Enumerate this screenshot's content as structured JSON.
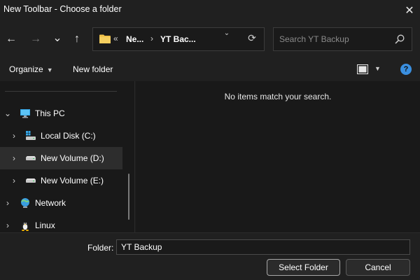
{
  "window": {
    "title": "New Toolbar - Choose a folder",
    "close_glyph": "✕"
  },
  "nav": {
    "back_glyph": "←",
    "forward_glyph": "→",
    "recent_glyph": "⌄",
    "up_glyph": "↑"
  },
  "address": {
    "overflow": "«",
    "segments": [
      "Ne...",
      "YT Bac..."
    ],
    "separator": "›",
    "refresh_glyph": "⟳"
  },
  "search": {
    "placeholder": "Search YT Backup"
  },
  "toolbar": {
    "organize_label": "Organize",
    "new_folder_label": "New folder",
    "help_glyph": "?"
  },
  "tree": {
    "items": [
      {
        "label": "This PC",
        "icon": "computer-icon"
      },
      {
        "label": "Local Disk (C:)",
        "icon": "system-drive-icon"
      },
      {
        "label": "New Volume (D:)",
        "icon": "drive-icon",
        "selected": true
      },
      {
        "label": "New Volume (E:)",
        "icon": "drive-icon"
      },
      {
        "label": "Network",
        "icon": "network-icon"
      },
      {
        "label": "Linux",
        "icon": "linux-penguin-icon"
      }
    ]
  },
  "content": {
    "empty_message": "No items match your search."
  },
  "footer": {
    "folder_label": "Folder:",
    "folder_value": "YT Backup",
    "select_label": "Select Folder",
    "cancel_label": "Cancel"
  },
  "colors": {
    "background": "#191919",
    "chrome": "#202020",
    "accent": "#3a8fe0",
    "folder_yellow": "#f0c24a"
  }
}
